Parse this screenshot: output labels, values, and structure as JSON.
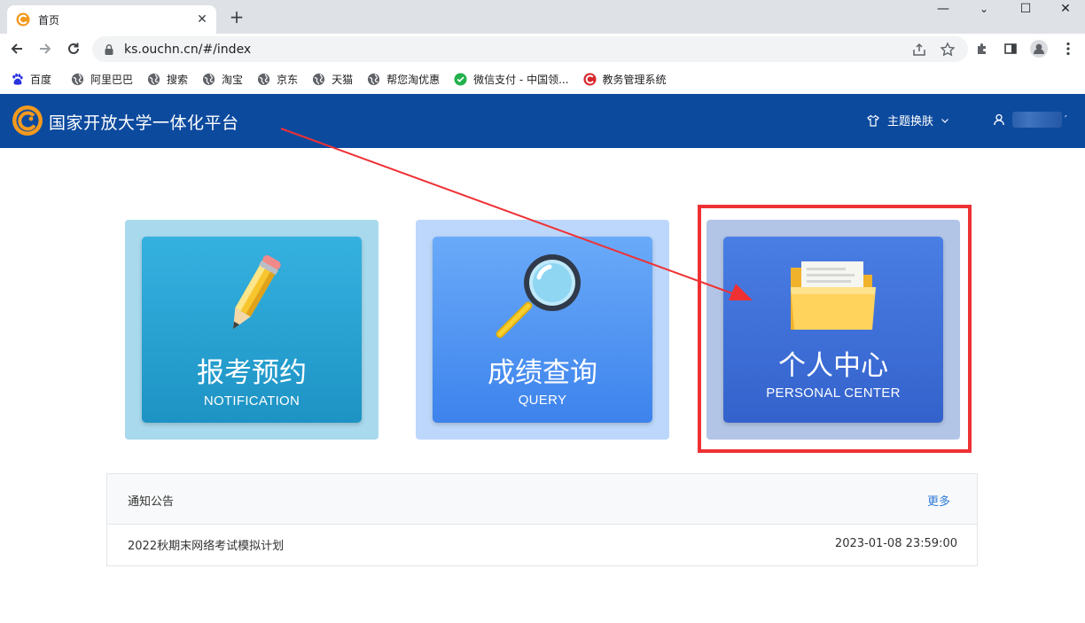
{
  "browser": {
    "tab": {
      "title": "首页"
    },
    "window_controls": {
      "minimize": "—",
      "maximize": "☐",
      "close": "✕"
    },
    "address": {
      "url": "ks.ouchn.cn/#/index"
    },
    "bookmarks": [
      {
        "label": "百度",
        "icon": "baidu-paw-icon"
      },
      {
        "label": "阿里巴巴",
        "icon": "globe-icon"
      },
      {
        "label": "搜索",
        "icon": "globe-icon"
      },
      {
        "label": "淘宝",
        "icon": "globe-icon"
      },
      {
        "label": "京东",
        "icon": "globe-icon"
      },
      {
        "label": "天猫",
        "icon": "globe-icon"
      },
      {
        "label": "帮您淘优惠",
        "icon": "globe-icon"
      },
      {
        "label": "微信支付 - 中国领...",
        "icon": "wechat-icon"
      },
      {
        "label": "教务管理系统",
        "icon": "ouchn-logo-icon"
      }
    ]
  },
  "header": {
    "title": "国家开放大学一体化平台",
    "theme_label": "主题换肤",
    "user_suffix": "′",
    "colors": {
      "bar": "#0c4a9e"
    }
  },
  "cards": [
    {
      "title": "报考预约",
      "subtitle": "NOTIFICATION",
      "icon": "pencil-icon",
      "outer": "#a9d9ec",
      "inner_from": "#35b1e0",
      "inner_to": "#1d93c4"
    },
    {
      "title": "成绩查询",
      "subtitle": "QUERY",
      "icon": "magnifier-icon",
      "outer": "#bcd7fb",
      "inner_from": "#6aaaf9",
      "inner_to": "#3d83ec"
    },
    {
      "title": "个人中心",
      "subtitle": "PERSONAL CENTER",
      "icon": "folder-icon",
      "outer": "#b3c5e6",
      "inner_from": "#4a7ee4",
      "inner_to": "#3462cc"
    }
  ],
  "annotation": {
    "highlight_color": "#ef3134"
  },
  "notice": {
    "title": "通知公告",
    "more": "更多",
    "items": [
      {
        "title": "2022秋期末网络考试模拟计划",
        "date": "2023-01-08 23:59:00"
      }
    ]
  }
}
